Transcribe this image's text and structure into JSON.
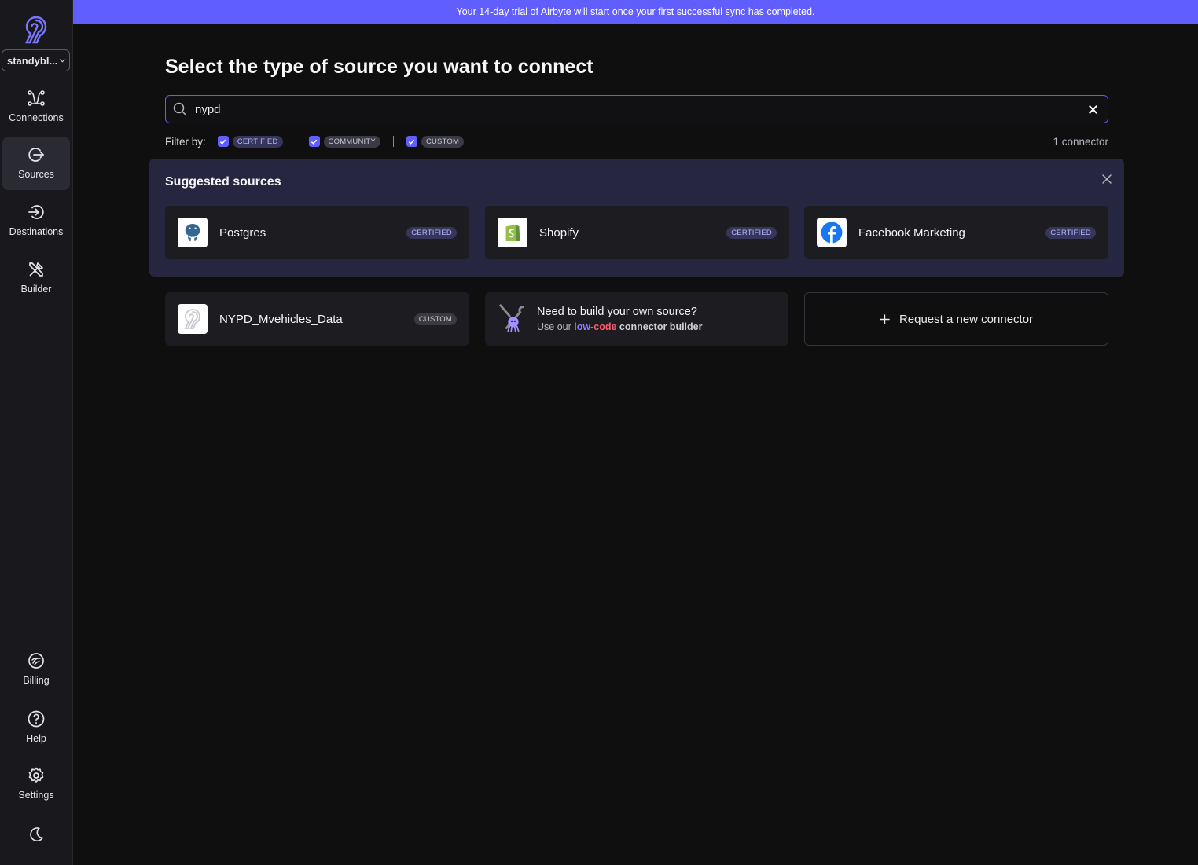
{
  "sidebar": {
    "workspace": "standybl...",
    "nav": [
      {
        "id": "connections",
        "label": "Connections",
        "icon": "connections-icon",
        "active": false
      },
      {
        "id": "sources",
        "label": "Sources",
        "icon": "sources-icon",
        "active": true
      },
      {
        "id": "destinations",
        "label": "Destinations",
        "icon": "destinations-icon",
        "active": false
      },
      {
        "id": "builder",
        "label": "Builder",
        "icon": "builder-icon",
        "active": false
      }
    ],
    "bottom": [
      {
        "id": "billing",
        "label": "Billing",
        "icon": "billing-icon"
      },
      {
        "id": "help",
        "label": "Help",
        "icon": "help-icon"
      },
      {
        "id": "settings",
        "label": "Settings",
        "icon": "gear-icon"
      }
    ],
    "theme_icon": "moon-icon"
  },
  "banner": {
    "text": "Your 14-day trial of Airbyte will start once your first successful sync has completed."
  },
  "page": {
    "title": "Select the type of source you want to connect"
  },
  "search": {
    "value": "nypd",
    "placeholder": ""
  },
  "filter": {
    "label": "Filter by:",
    "options": [
      {
        "label": "CERTIFIED",
        "checked": true
      },
      {
        "label": "COMMUNITY",
        "checked": true
      },
      {
        "label": "CUSTOM",
        "checked": true
      }
    ],
    "count": "1 connector"
  },
  "suggested": {
    "title": "Suggested sources",
    "items": [
      {
        "name": "Postgres",
        "badge": "CERTIFIED",
        "icon": "postgres-icon"
      },
      {
        "name": "Shopify",
        "badge": "CERTIFIED",
        "icon": "shopify-icon"
      },
      {
        "name": "Facebook Marketing",
        "badge": "CERTIFIED",
        "icon": "facebook-icon"
      }
    ]
  },
  "results": [
    {
      "name": "NYPD_Mvehicles_Data",
      "badge": "CUSTOM",
      "icon": "airbyte-icon"
    }
  ],
  "builder_card": {
    "title": "Need to build your own source?",
    "sub_prefix": "Use our ",
    "sub_low": "low-",
    "sub_code": "code",
    "sub_suffix": " connector builder"
  },
  "request": {
    "label": "Request a new connector"
  },
  "colors": {
    "accent": "#615eff",
    "banner": "#615eff",
    "suggested_bg": "#272640"
  }
}
